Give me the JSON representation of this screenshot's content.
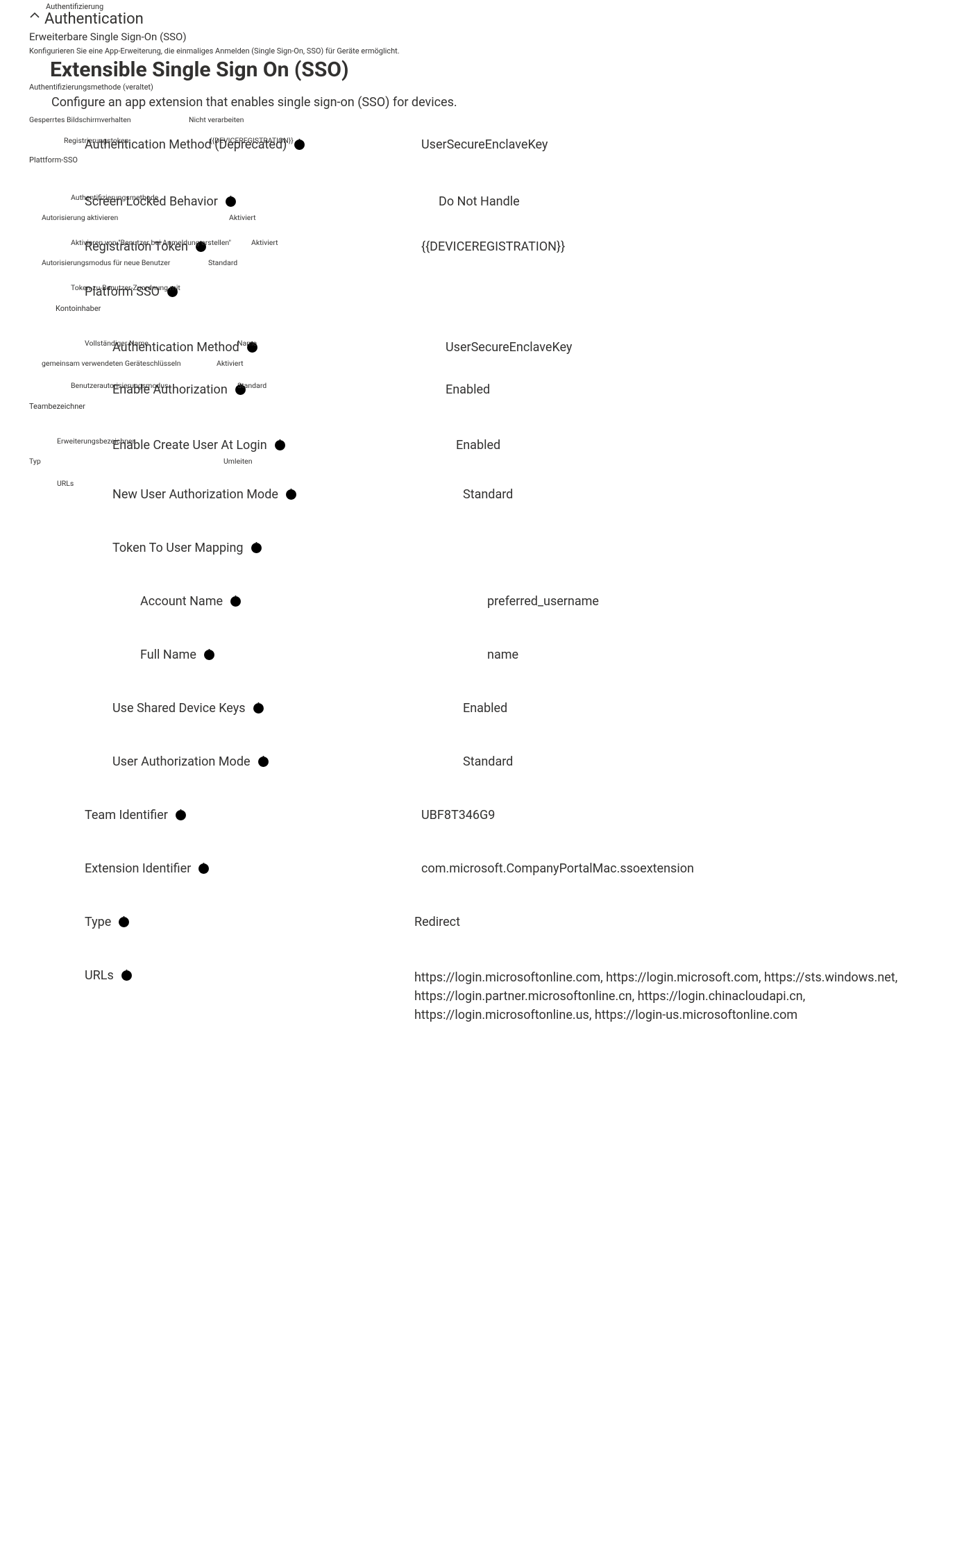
{
  "section": {
    "header_de": "Authentifizierung",
    "header_en": "Authentication",
    "title_de": "Erweiterbare Single Sign-On (SSO)",
    "hint_de": "Konfigurieren Sie eine App-Erweiterung, die einmaliges Anmelden (Single Sign-On, SSO) für Geräte ermöglicht.",
    "title_en": "Extensible Single Sign On (SSO)",
    "desc_en": "Configure an app extension that enables single sign-on (SSO) for devices."
  },
  "de": {
    "authmethod_deprecated": "Authentifizierungsmethode (veraltet)",
    "screen_locked": "Gesperrtes Bildschirmverhalten",
    "screen_locked_val": "Nicht verarbeiten",
    "reg_token": "Registrierungstoken",
    "reg_token_val": "{{DEVICEREGISTRATION}}",
    "platform_sso": "Plattform-SSO",
    "auth_method": "Authentifizierungsmethode",
    "enable_auth": "Autorisierung aktivieren",
    "enable_auth_val": "Aktiviert",
    "enable_create": "Aktivieren von \"Benutzer bei Anmeldung erstellen\"",
    "enable_create_val": "Aktiviert",
    "new_user_mode": "Autorisierungsmodus für neue Benutzer",
    "new_user_mode_val": "Standard",
    "token_mapping": "Token-zu-Benutzer-Zuordnung mit",
    "account_name": "Kontoinhaber",
    "full_name": "Vollständiger Name",
    "full_name_val": "Name",
    "shared_keys": "gemeinsam verwendeten Geräteschlüsseln",
    "shared_keys_val": "Aktiviert",
    "user_auth_mode": "Benutzerautorisierungsmodus",
    "user_auth_mode_val": "Standard",
    "team_id": "Teambezeichner",
    "ext_id": "Erweiterungsbezeichner",
    "type": "Typ",
    "type_val": "Umleiten",
    "urls": "URLs"
  },
  "fields": {
    "auth_method_deprecated": {
      "label": "Authentication Method (Deprecated)",
      "value": "UserSecureEnclaveKey"
    },
    "screen_locked": {
      "label": "Screen Locked Behavior",
      "value": "Do Not Handle"
    },
    "reg_token": {
      "label": "Registration Token",
      "value": "{{DEVICEREGISTRATION}}"
    },
    "platform_sso": {
      "label": "Platform SSO"
    },
    "auth_method": {
      "label": "Authentication Method",
      "value": "UserSecureEnclaveKey"
    },
    "enable_auth": {
      "label": "Enable Authorization",
      "value": "Enabled"
    },
    "enable_create": {
      "label": "Enable Create User At Login",
      "value": "Enabled"
    },
    "new_user_mode": {
      "label": "New User Authorization Mode",
      "value": "Standard"
    },
    "token_mapping": {
      "label": "Token To User Mapping"
    },
    "account_name": {
      "label": "Account Name",
      "value": "preferred_username"
    },
    "full_name": {
      "label": "Full Name",
      "value": "name"
    },
    "shared_keys": {
      "label": "Use Shared Device Keys",
      "value": "Enabled"
    },
    "user_auth_mode": {
      "label": "User Authorization Mode",
      "value": "Standard"
    },
    "team_id": {
      "label": "Team Identifier",
      "value": "UBF8T346G9"
    },
    "ext_id": {
      "label": "Extension Identifier",
      "value": "com.microsoft.CompanyPortalMac.ssoextension"
    },
    "type": {
      "label": "Type",
      "value": "Redirect"
    },
    "urls": {
      "label": "URLs",
      "value": "https://login.microsoftonline.com, https://login.microsoft.com, https://sts.windows.net, https://login.partner.microsoftonline.cn, https://login.chinacloudapi.cn, https://login.microsoftonline.us, https://login-us.microsoftonline.com"
    }
  }
}
